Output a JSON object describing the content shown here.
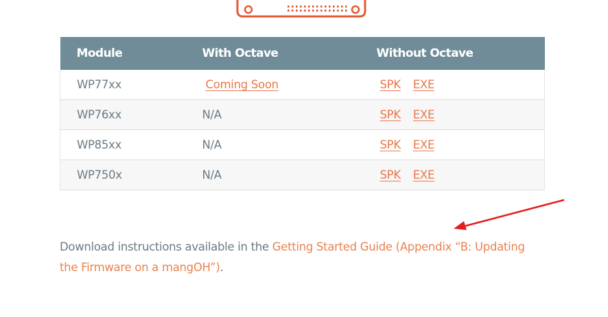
{
  "colors": {
    "header_bg": "#6f8c98",
    "link": "#e9774a",
    "body_text": "#6c7a83",
    "arrow": "#e51c1c",
    "graphic": "#e35a33"
  },
  "graphic": {
    "icon": "device-board-icon"
  },
  "table": {
    "headers": [
      "Module",
      "With Octave",
      "Without Octave"
    ],
    "rows": [
      {
        "module": "WP77xx",
        "with_octave": "Coming Soon",
        "with_octave_is_link": true,
        "spk": "SPK",
        "exe": "EXE"
      },
      {
        "module": "WP76xx",
        "with_octave": "N/A",
        "with_octave_is_link": false,
        "spk": "SPK",
        "exe": "EXE"
      },
      {
        "module": "WP85xx",
        "with_octave": "N/A",
        "with_octave_is_link": false,
        "spk": "SPK",
        "exe": "EXE"
      },
      {
        "module": "WP750x",
        "with_octave": "N/A",
        "with_octave_is_link": false,
        "spk": "SPK",
        "exe": "EXE"
      }
    ]
  },
  "instructions": {
    "prefix": "Download instructions available in the ",
    "link_text": "Getting Started Guide (Appendix “B: Updating the Firmware on a mangOH”)",
    "suffix": "."
  },
  "annotation": {
    "icon": "red-arrow-icon"
  }
}
